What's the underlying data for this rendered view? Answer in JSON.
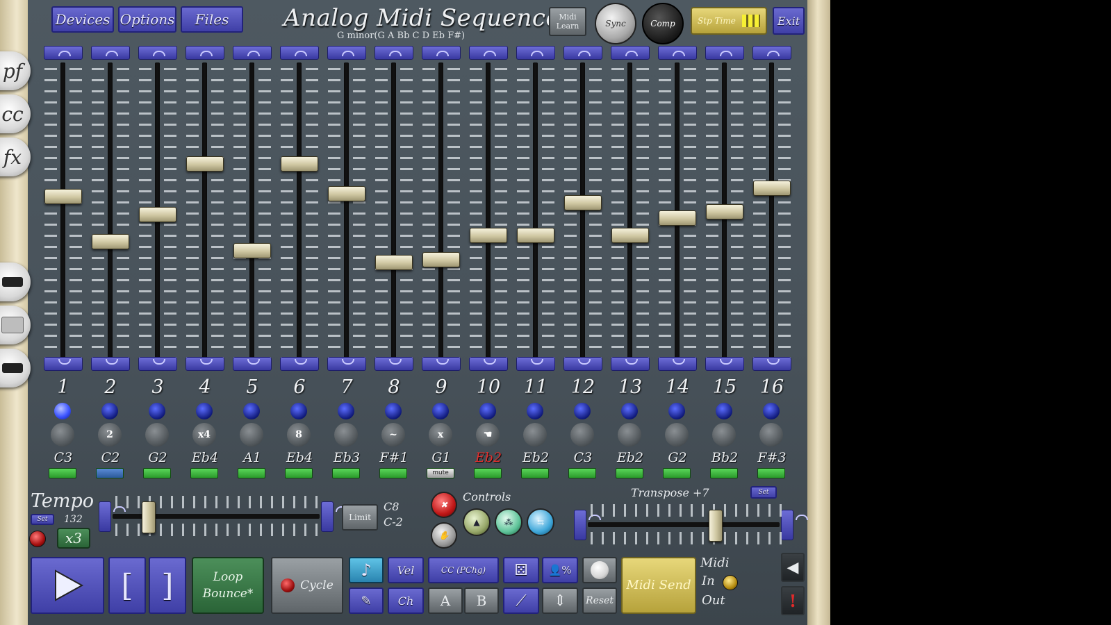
{
  "app": {
    "title": "Analog Midi Sequencer",
    "scale": "G minor(G A Bb C D Eb F#)"
  },
  "menu": {
    "devices": "Devices",
    "options": "Options",
    "files": "Files"
  },
  "top_right": {
    "midi_learn": "Midi Learn",
    "sync": "Sync",
    "comp": "Comp",
    "step_time": "Stp Time",
    "exit": "Exit"
  },
  "side_tabs": [
    "pf",
    "cc",
    "fx"
  ],
  "channels": [
    {
      "num": "1",
      "note": "C3",
      "level": 0.55,
      "knob": "",
      "led_on": true,
      "gate": "green"
    },
    {
      "num": "2",
      "note": "C2",
      "level": 0.4,
      "knob": "2",
      "led_on": false,
      "gate": "blue"
    },
    {
      "num": "3",
      "note": "G2",
      "level": 0.49,
      "knob": "",
      "led_on": false,
      "gate": "green"
    },
    {
      "num": "4",
      "note": "Eb4",
      "level": 0.66,
      "knob": "x4",
      "led_on": false,
      "gate": "green"
    },
    {
      "num": "5",
      "note": "A1",
      "level": 0.37,
      "knob": "",
      "led_on": false,
      "gate": "green"
    },
    {
      "num": "6",
      "note": "Eb4",
      "level": 0.66,
      "knob": "8",
      "led_on": false,
      "gate": "green"
    },
    {
      "num": "7",
      "note": "Eb3",
      "level": 0.56,
      "knob": "",
      "led_on": false,
      "gate": "green"
    },
    {
      "num": "8",
      "note": "F#1",
      "level": 0.33,
      "knob": "~",
      "led_on": false,
      "gate": "green"
    },
    {
      "num": "9",
      "note": "G1",
      "level": 0.34,
      "knob": "x",
      "led_on": false,
      "gate": "mute",
      "gate_label": "mute"
    },
    {
      "num": "10",
      "note": "Eb2",
      "level": 0.42,
      "knob": "☚",
      "led_on": false,
      "gate": "green",
      "note_red": true
    },
    {
      "num": "11",
      "note": "Eb2",
      "level": 0.42,
      "knob": "",
      "led_on": false,
      "gate": "green"
    },
    {
      "num": "12",
      "note": "C3",
      "level": 0.53,
      "knob": "",
      "led_on": false,
      "gate": "green"
    },
    {
      "num": "13",
      "note": "Eb2",
      "level": 0.42,
      "knob": "",
      "led_on": false,
      "gate": "green"
    },
    {
      "num": "14",
      "note": "G2",
      "level": 0.48,
      "knob": "",
      "led_on": false,
      "gate": "green"
    },
    {
      "num": "15",
      "note": "Bb2",
      "level": 0.5,
      "knob": "",
      "led_on": false,
      "gate": "green"
    },
    {
      "num": "16",
      "note": "F#3",
      "level": 0.58,
      "knob": "",
      "led_on": false,
      "gate": "green"
    }
  ],
  "tempo": {
    "label": "Tempo",
    "value": "132",
    "set": "Set",
    "mult": "x3",
    "limit": "Limit",
    "range_high": "C8",
    "range_low": "C-2"
  },
  "controls_label": "Controls",
  "transpose": {
    "label": "Transpose +7",
    "set": "Set"
  },
  "bottom": {
    "loop": "Loop Bounce*",
    "cycle": "Cycle",
    "vel": "Vel",
    "cc": "CC (PChg)",
    "ch": "Ch",
    "a": "A",
    "b": "B",
    "reset": "Reset",
    "midi_send": "Midi Send",
    "midi": "Midi",
    "in": "In",
    "out": "Out",
    "pct": "%"
  },
  "colors": {
    "panel": "#4e5961",
    "accent_purple": "#4b4bb8",
    "gold": "#cbb64f",
    "green": "#3e8a4c"
  }
}
